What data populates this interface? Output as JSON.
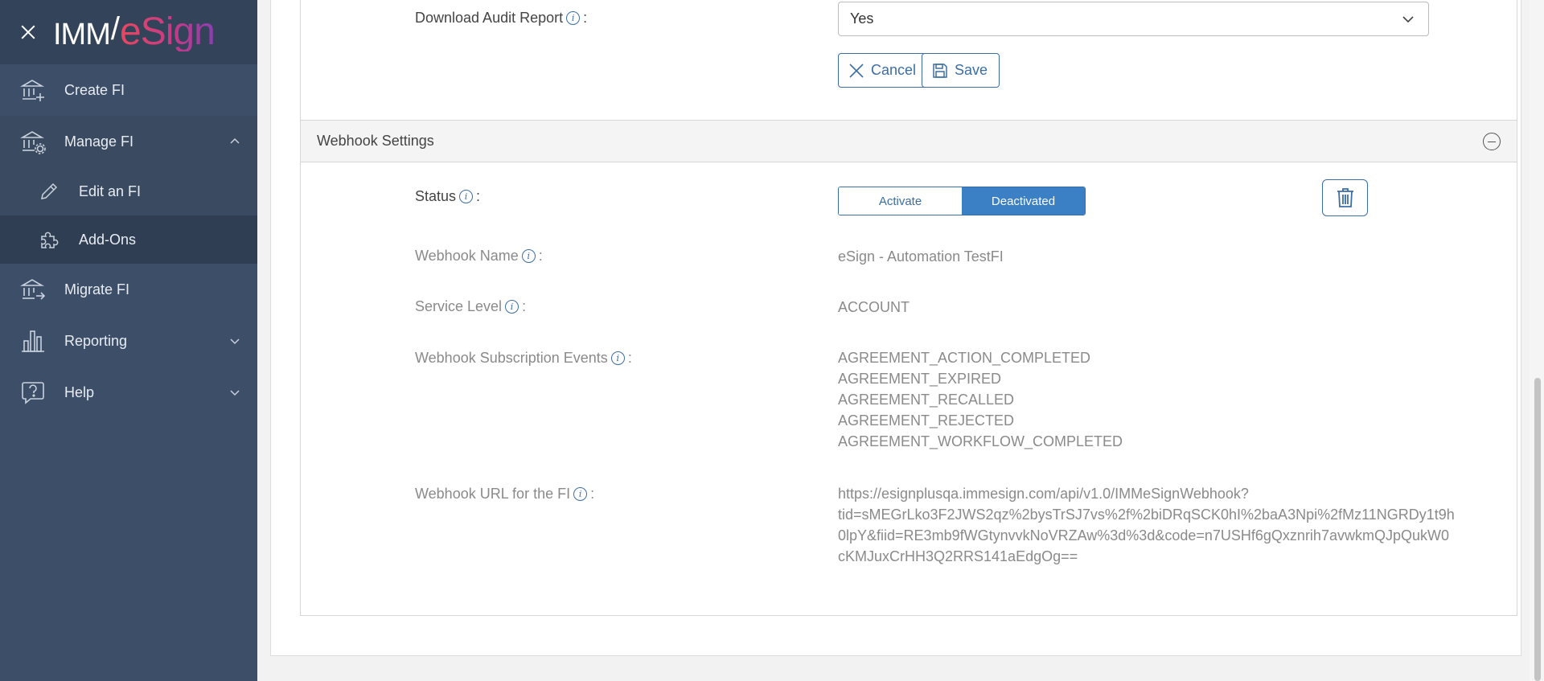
{
  "sidebar": {
    "logo": {
      "imm": "IMM",
      "slash": "/",
      "esign": "eSign"
    },
    "items": [
      {
        "label": "Create FI",
        "icon": "bank-plus-icon"
      },
      {
        "label": "Manage FI",
        "icon": "bank-gear-icon"
      },
      {
        "label": "Edit an FI",
        "icon": "pencil-icon"
      },
      {
        "label": "Add-Ons",
        "icon": "puzzle-icon"
      },
      {
        "label": "Migrate FI",
        "icon": "bank-arrow-icon"
      },
      {
        "label": "Reporting",
        "icon": "bar-chart-icon"
      },
      {
        "label": "Help",
        "icon": "help-bubble-icon"
      }
    ]
  },
  "audit": {
    "label": "Download Audit Report",
    "colon": ":",
    "value": "Yes",
    "cancel": "Cancel",
    "save": "Save"
  },
  "webhook": {
    "section_title": "Webhook Settings",
    "status_label": "Status",
    "status_options": [
      "Activate",
      "Deactivated"
    ],
    "status_selected": "Deactivated",
    "name_label": "Webhook Name",
    "name_value": "eSign - Automation TestFI",
    "service_label": "Service Level",
    "service_value": "ACCOUNT",
    "events_label": "Webhook Subscription Events",
    "events": [
      "AGREEMENT_ACTION_COMPLETED",
      "AGREEMENT_EXPIRED",
      "AGREEMENT_RECALLED",
      "AGREEMENT_REJECTED",
      "AGREEMENT_WORKFLOW_COMPLETED"
    ],
    "url_label": "Webhook URL for the FI",
    "url_lines": [
      "https://esignplusqa.immesign.com/api/v1.0/IMMeSignWebhook?",
      "tid=sMEGrLko3F2JWS2qz%2bysTrSJ7vs%2f%2biDRqSCK0hI%2baA3Npi%2fMz11NGRDy1t9h",
      "0lpY&fiid=RE3mb9fWGtynvvkNoVRZAw%3d%3d&code=n7USHf6gQxznrih7avwkmQJpQukW0",
      "cKMJuxCrHH3Q2RRS141aEdgOg=="
    ]
  },
  "colors": {
    "sidebar_bg": "#3d4f68",
    "accent": "#3b6ea5",
    "toggle_on": "#3b7fc4"
  }
}
